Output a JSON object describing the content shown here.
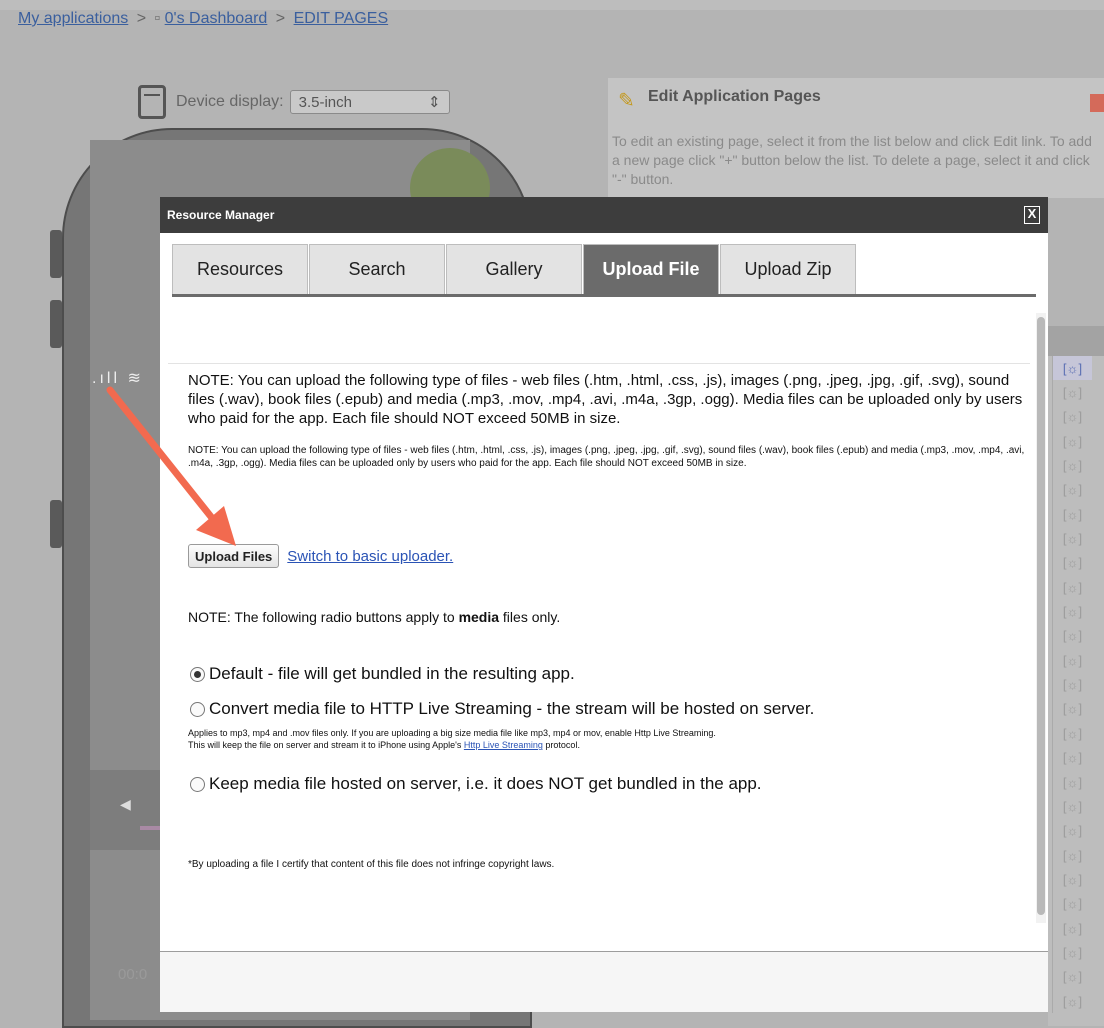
{
  "breadcrumb": {
    "root": "My applications",
    "sep1": ">",
    "square": "▫",
    "dashboard": "0's Dashboard",
    "sep2": ">",
    "current": "EDIT PAGES"
  },
  "device": {
    "label": "Device display:",
    "selected": "3.5-inch",
    "arrow": "⇕"
  },
  "edit_pages": {
    "title": "Edit Application Pages",
    "description": "To edit an existing page, select it from the list below and click Edit link. To add a new page click \"+\" button below the list. To delete a page, select it and click \"-\" button."
  },
  "phone": {
    "status": ".ıll ≋",
    "speaker": "◀",
    "time": "00:0"
  },
  "gear_icon_glyph": "[☼]",
  "modal": {
    "title": "Resource Manager",
    "close": "X",
    "tabs": [
      {
        "label": "Resources"
      },
      {
        "label": "Search"
      },
      {
        "label": "Gallery"
      },
      {
        "label": "Upload File"
      },
      {
        "label": "Upload Zip"
      }
    ],
    "active_tab": "Upload File",
    "note_large": "NOTE: You can upload the following type of files - web files (.htm, .html, .css, .js), images (.png, .jpeg, .jpg, .gif, .svg), sound files (.wav), book files (.epub) and media (.mp3, .mov, .mp4, .avi, .m4a, .3gp, .ogg). Media files can be uploaded only by users who paid for the app. Each file should NOT exceed 50MB in size.",
    "note_small": "NOTE: You can upload the following type of files - web files (.htm, .html, .css, .js), images (.png, .jpeg, .jpg, .gif, .svg), sound files (.wav), book files (.epub) and media (.mp3, .mov, .mp4, .avi, .m4a, .3gp, .ogg). Media files can be uploaded only by users who paid for the app. Each file should NOT exceed 50MB in size.",
    "upload_button": "Upload Files",
    "switch_link": "Switch to basic uploader.",
    "radio_note_prefix": "NOTE: The following radio buttons apply to ",
    "radio_note_bold": "media",
    "radio_note_suffix": " files only.",
    "radio_default": "Default - file will get bundled in the resulting app.",
    "radio_hls": "Convert media file to HTTP Live Streaming - the stream will be hosted on server.",
    "hls_help_line1": "Applies to mp3, mp4 and .mov files only. If you are uploading a big size media file like mp3, mp4 or mov, enable Http Live Streaming.",
    "hls_help_line2_prefix": "This will keep the file on server and stream it to iPhone using Apple's ",
    "hls_help_link": "Http Live Streaming",
    "hls_help_line2_suffix": " protocol.",
    "radio_keep": "Keep media file hosted on server, i.e. it does NOT get bundled in the app.",
    "certify": "*By uploading a file I certify that content of this file does not infringe copyright laws."
  },
  "colors": {
    "arrow": "#f26a4f",
    "active_tab": "#6b6b6b",
    "titlebar": "#3d3d3d",
    "link": "#2a53b5"
  }
}
